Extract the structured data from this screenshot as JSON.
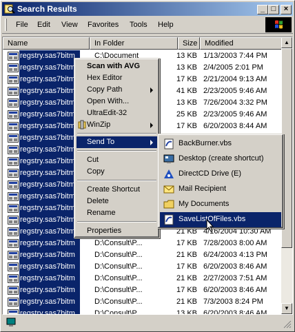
{
  "window": {
    "title": "Search Results",
    "controls": {
      "minimize": "_",
      "maximize": "□",
      "close": "×"
    }
  },
  "menubar": {
    "items": [
      "File",
      "Edit",
      "View",
      "Favorites",
      "Tools",
      "Help"
    ]
  },
  "columns": {
    "name": "Name",
    "folder": "In Folder",
    "size": "Size",
    "modified": "Modified"
  },
  "rows": [
    {
      "name": "regstry.sas7bitm",
      "folder": "C:\\Document",
      "size": "13 KB",
      "modified": "1/13/2003 7:44 PM"
    },
    {
      "name": "regstry.sas7bitm",
      "folder": "",
      "size": "13 KB",
      "modified": "2/4/2005 2:01 PM"
    },
    {
      "name": "regstry.sas7bitm",
      "folder": "",
      "size": "17 KB",
      "modified": "2/21/2004 9:13 AM"
    },
    {
      "name": "regstry.sas7bitm",
      "folder": "",
      "size": "41 KB",
      "modified": "2/23/2005 9:46 AM"
    },
    {
      "name": "regstry.sas7bitm",
      "folder": "",
      "size": "13 KB",
      "modified": "7/26/2004 3:32 PM"
    },
    {
      "name": "regstry.sas7bitm",
      "folder": "",
      "size": "25 KB",
      "modified": "2/23/2005 9:46 AM"
    },
    {
      "name": "regstry.sas7bitm",
      "folder": "",
      "size": "17 KB",
      "modified": "6/20/2003 8:44 AM"
    },
    {
      "name": "regstry.sas7bitm",
      "folder": "",
      "size": "",
      "modified": ""
    },
    {
      "name": "regstry.sas7bitm",
      "folder": "",
      "size": "",
      "modified": ""
    },
    {
      "name": "regstry.sas7bitm",
      "folder": "",
      "size": "",
      "modified": ""
    },
    {
      "name": "regstry.sas7bitm",
      "folder": "",
      "size": "",
      "modified": ""
    },
    {
      "name": "regstry.sas7bitm",
      "folder": "",
      "size": "",
      "modified": ""
    },
    {
      "name": "regstry.sas7bitm",
      "folder": "",
      "size": "",
      "modified": ""
    },
    {
      "name": "regstry.sas7bitm",
      "folder": "",
      "size": "",
      "modified": ""
    },
    {
      "name": "regstry.sas7bitm",
      "folder": "",
      "size": "",
      "modified": ""
    },
    {
      "name": "regstry.sas7bitm",
      "folder": "",
      "size": "21 KB",
      "modified": "4/16/2004 10:30 AM"
    },
    {
      "name": "regstry.sas7bitm",
      "folder": "D:\\Consult\\P...",
      "size": "17 KB",
      "modified": "7/28/2003 8:00 AM"
    },
    {
      "name": "regstry.sas7bitm",
      "folder": "D:\\Consult\\P...",
      "size": "21 KB",
      "modified": "6/24/2003 4:13 PM"
    },
    {
      "name": "regstry.sas7bitm",
      "folder": "D:\\Consult\\P...",
      "size": "17 KB",
      "modified": "6/20/2003 8:46 AM"
    },
    {
      "name": "regstry.sas7bitm",
      "folder": "D:\\Consult\\P...",
      "size": "21 KB",
      "modified": "2/27/2003 7:51 AM"
    },
    {
      "name": "regstry.sas7bitm",
      "folder": "D:\\Consult\\P...",
      "size": "17 KB",
      "modified": "6/20/2003 8:46 AM"
    },
    {
      "name": "regstry.sas7bitm",
      "folder": "D:\\Consult\\P...",
      "size": "21 KB",
      "modified": "7/3/2003 8:24 PM"
    },
    {
      "name": "regstry.sas7bitm",
      "folder": "D:\\Consult\\P...",
      "size": "13 KB",
      "modified": "6/20/2003 8:46 AM"
    },
    {
      "name": "regstry.sas7bitm",
      "folder": "",
      "size": "",
      "modified": ""
    }
  ],
  "context_menu": {
    "scan": "Scan with AVG",
    "hex_editor": "Hex Editor",
    "copy_path": "Copy Path",
    "open_with": "Open With...",
    "ultraedit": "UltraEdit-32",
    "winzip": "WinZip",
    "send_to": "Send To",
    "cut": "Cut",
    "copy": "Copy",
    "create_shortcut": "Create Shortcut",
    "delete": "Delete",
    "rename": "Rename",
    "properties": "Properties"
  },
  "send_to_menu": {
    "backburner": "BackBurner.vbs",
    "desktop": "Desktop (create shortcut)",
    "directcd": "DirectCD Drive (E)",
    "mail": "Mail Recipient",
    "mydocs": "My Documents",
    "savelist": "SaveListOfFiles.vbs"
  },
  "colors": {
    "selection": "#0a246a",
    "face": "#d4d0c8"
  }
}
